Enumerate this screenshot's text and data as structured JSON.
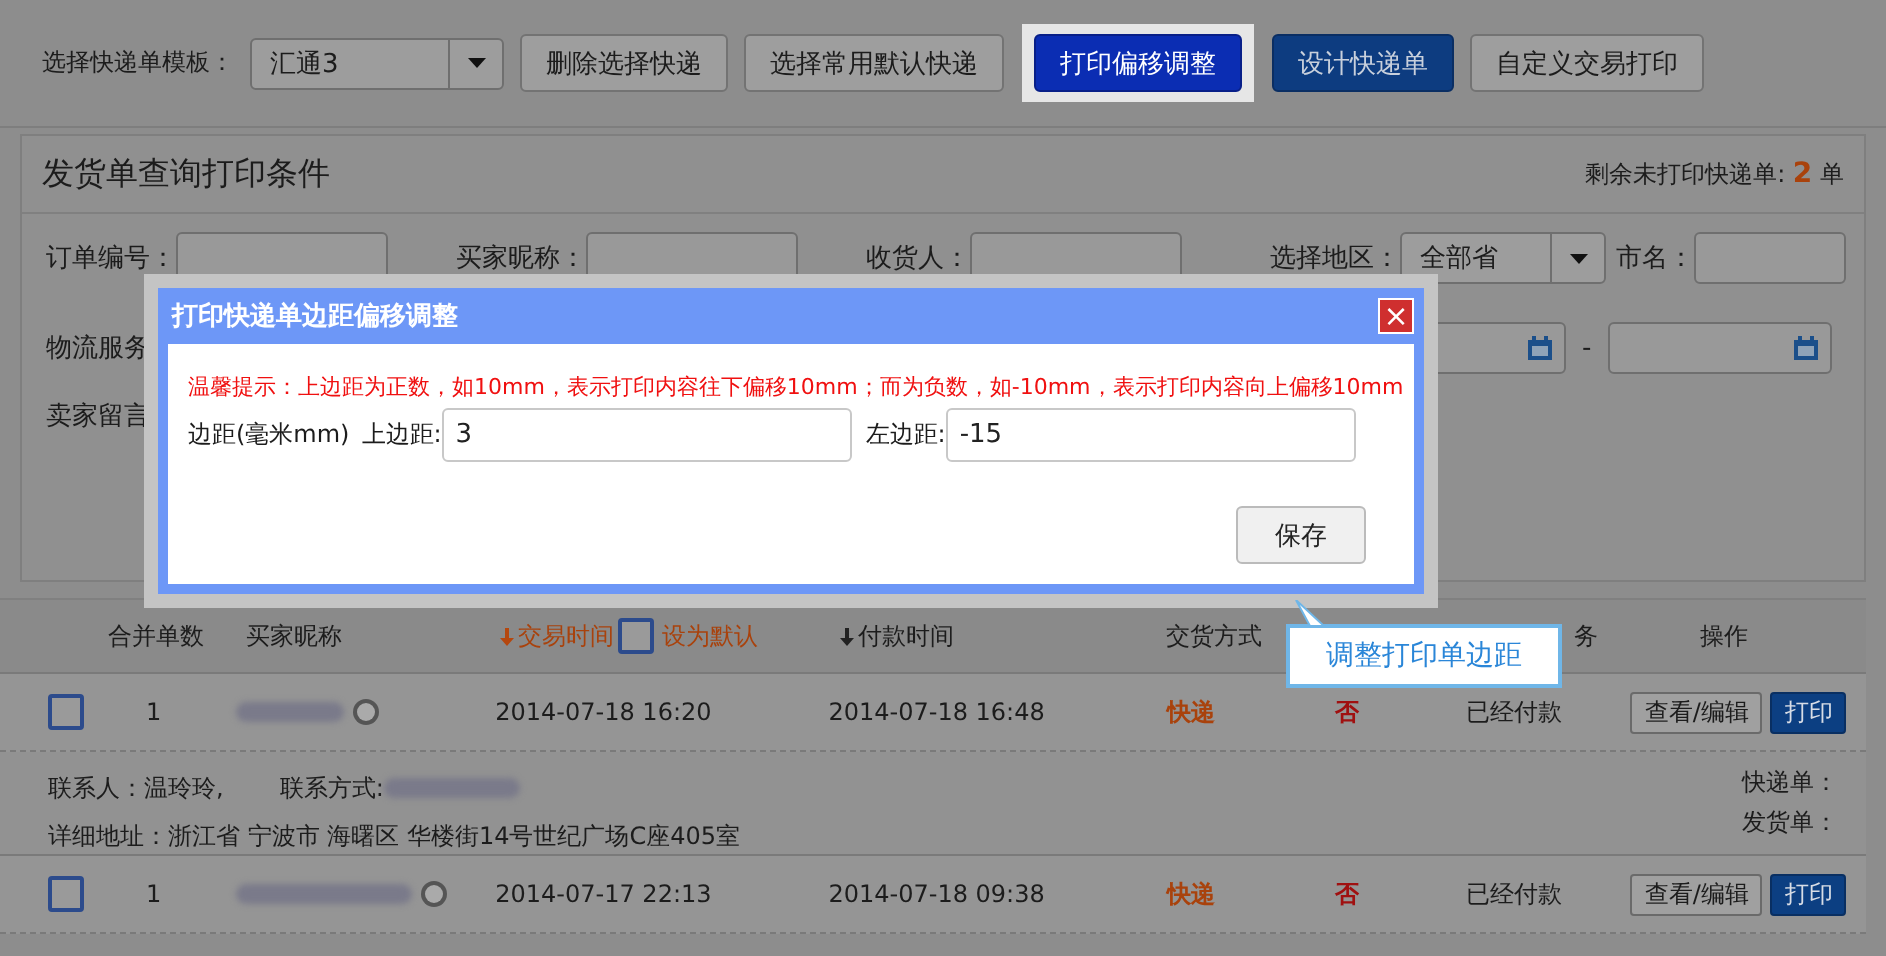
{
  "toolbar": {
    "template_label": "选择快递单模板：",
    "template_value": "汇通3",
    "buttons": [
      {
        "label": "删除选择快递",
        "kind": "plain"
      },
      {
        "label": "选择常用默认快递",
        "kind": "plain"
      },
      {
        "label": "打印偏移调整",
        "kind": "highlight"
      },
      {
        "label": "设计快递单",
        "kind": "primary"
      },
      {
        "label": "自定义交易打印",
        "kind": "plain"
      }
    ]
  },
  "query_panel": {
    "title": "发货单查询打印条件",
    "remaining_label": "剩余未打印快递单:",
    "remaining_count": "2",
    "remaining_unit": "单",
    "row1": [
      {
        "label": "订单编号：",
        "kind": "input"
      },
      {
        "label": "买家昵称：",
        "kind": "input"
      },
      {
        "label": "收货人：",
        "kind": "input"
      },
      {
        "label": "选择地区：",
        "kind": "select",
        "value": "全部省"
      },
      {
        "label": "市名：",
        "kind": "input"
      }
    ],
    "row2_label": "物流服务",
    "date_separator": "-",
    "row3_label": "卖家留言"
  },
  "table": {
    "columns": [
      {
        "label": "合并单数",
        "kind": "plain"
      },
      {
        "label": "买家昵称",
        "kind": "plain"
      },
      {
        "label": "交易时间",
        "kind": "sort_active"
      },
      {
        "label": "设为默认",
        "kind": "checkbox",
        "checked": false
      },
      {
        "label": "付款时间",
        "kind": "sort"
      },
      {
        "label": "交货方式",
        "kind": "plain"
      },
      {
        "label": "务",
        "kind": "plain"
      },
      {
        "label": "操作",
        "kind": "plain"
      }
    ],
    "rows": [
      {
        "checked": false,
        "count": "1",
        "trade_time": "2014-07-18 16:20",
        "pay_time": "2014-07-18 16:48",
        "delivery": "快递",
        "flag": "否",
        "status": "已经付款",
        "actions": [
          "查看/编辑",
          "打印"
        ],
        "details": {
          "contact": "联系人：温玲玲,",
          "phone_label": "联系方式:",
          "address": "详细地址：浙江省 宁波市 海曙区 华楼街14号世纪广场C座405室",
          "express_label": "快递单：",
          "invoice_label": "发货单："
        }
      },
      {
        "checked": false,
        "count": "1",
        "trade_time": "2014-07-17 22:13",
        "pay_time": "2014-07-18 09:38",
        "delivery": "快递",
        "flag": "否",
        "status": "已经付款",
        "actions": [
          "查看/编辑",
          "打印"
        ]
      }
    ]
  },
  "dialog": {
    "title": "打印快递单边距偏移调整",
    "close": "×",
    "hint": "温馨提示：上边距为正数，如10mm，表示打印内容往下偏移10mm；而为负数，如-10mm，表示打印内容向上偏移10mm",
    "margin_label": "边距(毫米mm)",
    "top_label": "上边距:",
    "top_value": "3",
    "left_label": "左边距:",
    "left_value": "-15",
    "save": "保存"
  },
  "callout": "调整打印单边距"
}
